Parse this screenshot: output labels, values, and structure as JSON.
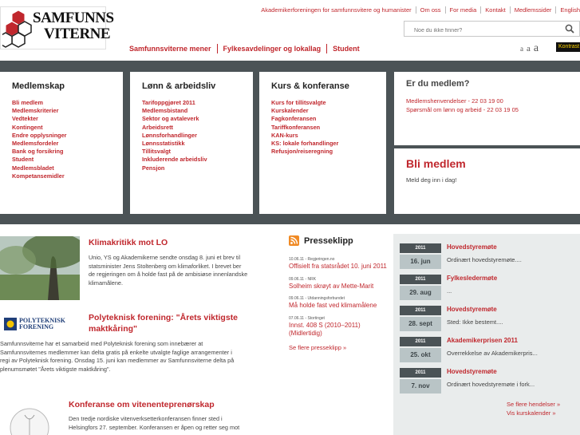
{
  "logo": {
    "line1": "SAMFUNNS",
    "line2": "VITERNE"
  },
  "topnav": [
    "Akademikerforeningen for samfunnsvitere og humanister",
    "Om oss",
    "For media",
    "Kontakt",
    "Medlemssider",
    "English"
  ],
  "search": {
    "placeholder": "Noe du ikke finner?"
  },
  "mainnav": [
    "Samfunnsviterne mener",
    "Fylkesavdelinger og lokallag",
    "Student"
  ],
  "textsize": {
    "small": "a",
    "medium": "a",
    "large": "a"
  },
  "contrast_label": "Kontrast",
  "columns": [
    {
      "title": "Medlemskap",
      "items": [
        "Bli medlem",
        "Medlemskriterier",
        "Vedtekter",
        "Kontingent",
        "Endre opplysninger",
        "Medlemsfordeler",
        "Bank og forsikring",
        "Student",
        "Medlemsbladet",
        "Kompetansemidler"
      ]
    },
    {
      "title": "Lønn & arbeidsliv",
      "items": [
        "Tarifoppgjøret 2011",
        "Medlemsbistand",
        "Sektor og avtaleverk",
        "Arbeidsrett",
        "Lønnsforhandlinger",
        "Lønnsstatistikk",
        "Tillitsvalgt",
        "Inkluderende arbeidsliv",
        "Pensjon"
      ]
    },
    {
      "title": "Kurs & konferanse",
      "items": [
        "Kurs for tillitsvalgte",
        "Kurskalender",
        "Fagkonferansen",
        "Tariffkonferansen",
        "KAN-kurs",
        "KS: lokale forhandlinger",
        "Refusjon/reiseregning"
      ]
    }
  ],
  "erdu": {
    "title": "Er du medlem?",
    "line1": "Medlemshenvendelser - 22 03 19 00",
    "line2": "Spørsmål om lønn og arbeid - 22 03 19 05"
  },
  "blimedlem": {
    "title": "Bli medlem",
    "text": "Meld deg inn i dag!"
  },
  "news": [
    {
      "title": "Klimakritikk mot LO",
      "text": [
        "Unio, YS og Akademikerne sendte onsdag 8. juni et brev til",
        "statsminister Jens Stoltenberg om klimaforliket. I brevet ber",
        "de regjeringen om å holde fast på de ambisiøse innenlandske",
        "klimamålene."
      ]
    },
    {
      "title": "Polyteknisk forening: \"Årets viktigste maktkåring\"",
      "text": [
        "Samfunnsviterne har et samarbeid med Polyteknisk forening som innebærer at",
        "Samfunnsviternes medlemmer kan delta gratis på enkelte utvalgte faglige arrangementer i",
        "regi av Polyteknisk forening. Onsdag 15. juni kan medlemmer av Samfunnsviterne delta på",
        "plenumsmøtet \"Årets viktigste maktkåring\"."
      ],
      "logo": {
        "line1": "POLYTEKNISK",
        "line2": "FORENING"
      }
    },
    {
      "title": "Konferanse om vitenenteprenørskap",
      "text": [
        "Den tredje nordiske vitenverksetterkonferansen finner sted i",
        "Helsingfors 27. september. Konferansen er åpen og retter seg mot"
      ]
    }
  ],
  "presse": {
    "title": "Presseklipp",
    "items": [
      {
        "date": "10.06.11",
        "source": "Regjeringen.no",
        "title": "Offisielt fra statsrådet 10. juni 2011"
      },
      {
        "date": "09.06.11",
        "source": "NRK",
        "title": "Solheim skrøyt av Mette-Marit"
      },
      {
        "date": "09.06.11",
        "source": "Utdanningsforbundet",
        "title": "Må holde fast ved klimamålene"
      },
      {
        "date": "07.06.11",
        "source": "Stortinget",
        "title": "Innst. 408 S (2010–2011) (Midlertidig)"
      }
    ],
    "more": "Se flere presseklipp »"
  },
  "events": {
    "items": [
      {
        "year": "2011",
        "day": "16. jun",
        "title": "Hovedstyremøte",
        "desc": "Ordinært hovedstyremøte...."
      },
      {
        "year": "2011",
        "day": "29. aug",
        "title": "Fylkesledermøte",
        "desc": "..."
      },
      {
        "year": "2011",
        "day": "28. sept",
        "title": "Hovedstyremøte",
        "desc": "Sted: Ikke bestemt...."
      },
      {
        "year": "2011",
        "day": "25. okt",
        "title": "Akademikerprisen 2011",
        "desc": "Overrekkelse av Akademikerpris..."
      },
      {
        "year": "2011",
        "day": "7. nov",
        "title": "Hovedstyremøte",
        "desc": "Ordinært hovedstyremøte i fork..."
      }
    ],
    "more1": "Se flere hendelser »",
    "more2": "Vis kurskalender »"
  }
}
